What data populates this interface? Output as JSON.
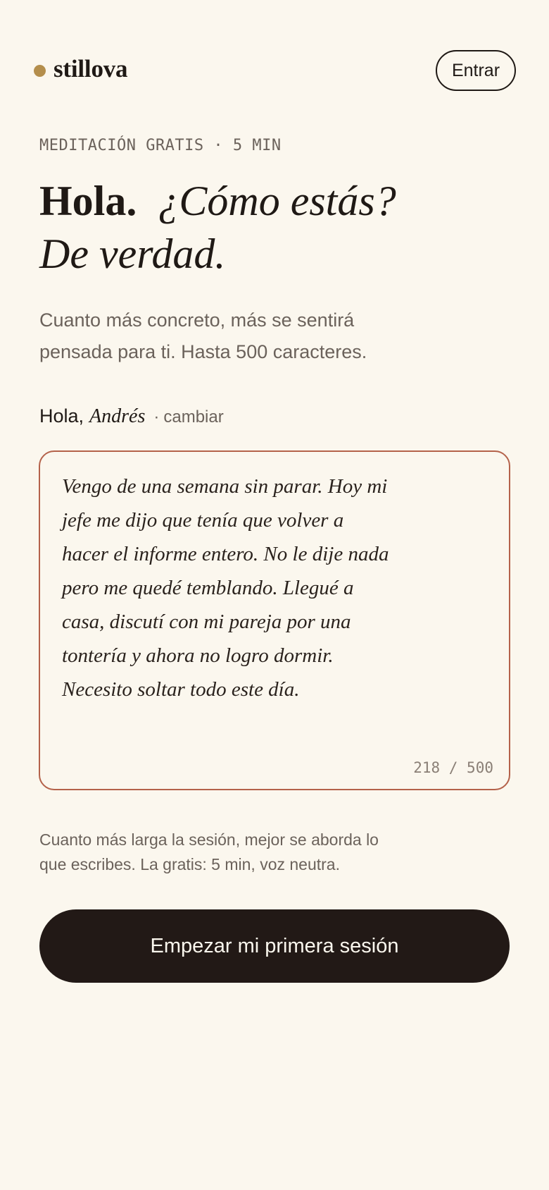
{
  "header": {
    "brand": "stillova",
    "login_label": "Entrar"
  },
  "hero": {
    "eyebrow": "MEDITACIÓN GRATIS · 5 MIN",
    "headline_bold": "Hola.",
    "headline_italic_1": "¿Cómo estás?",
    "headline_italic_2": "De verdad.",
    "subtitle": "Cuanto más concreto, más se sentirá pensada para ti. Hasta 500 caracteres."
  },
  "greeting": {
    "hola": "Hola,",
    "name": "Andrés",
    "separator": "·",
    "change_label": "cambiar"
  },
  "entry": {
    "text": "Vengo de una semana sin parar. Hoy mi jefe me dijo que tenía que volver a hacer el informe entero. No le dije nada pero me quedé temblando. Llegué a casa, discutí con mi pareja por una tontería y ahora no logro dormir. Necesito soltar todo este día.",
    "counter": "218 / 500"
  },
  "note": "Cuanto más larga la sesión, mejor se aborda lo que escribes. La gratis: 5 min, voz neutra.",
  "cta_label": "Empezar mi primera sesión",
  "colors": {
    "background": "#fbf7ee",
    "brand_dot": "#b48e4c",
    "textarea_border": "#b4624a",
    "cta_background": "#221916"
  }
}
